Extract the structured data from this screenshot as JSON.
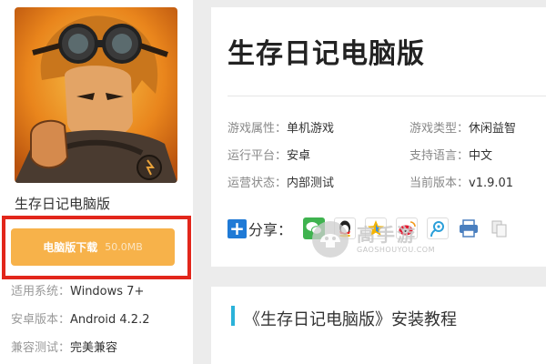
{
  "app": {
    "name": "生存日记电脑版",
    "title": "生存日记电脑版"
  },
  "download": {
    "label": "电脑版下载",
    "size": "50.0MB"
  },
  "left_meta": [
    {
      "key": "适用系统：",
      "value": "Windows 7+"
    },
    {
      "key": "安卓版本：",
      "value": "Android 4.2.2"
    },
    {
      "key": "兼容测试：",
      "value": "完美兼容"
    }
  ],
  "attributes": [
    {
      "key": "游戏属性：",
      "value": "单机游戏"
    },
    {
      "key": "游戏类型：",
      "value": "休闲益智"
    },
    {
      "key": "运行平台：",
      "value": "安卓"
    },
    {
      "key": "支持语言：",
      "value": "中文"
    },
    {
      "key": "运营状态：",
      "value": "内部测试"
    },
    {
      "key": "当前版本：",
      "value": "v1.9.01"
    }
  ],
  "share": {
    "plus": "+",
    "label": "分享：",
    "icons": [
      "wechat-icon",
      "qq-icon",
      "qzone-icon",
      "weibo-icon",
      "tencent-weibo-icon",
      "print-icon",
      "copy-icon"
    ]
  },
  "watermark": {
    "text": "高手游",
    "sub": "GAOSHOUYOU.COM"
  },
  "tutorial": {
    "title": "《生存日记电脑版》安装教程"
  },
  "colors": {
    "download_button": "#f7b24a",
    "highlight_outline": "#e2261b",
    "accent_bar": "#2bb2d9",
    "share_plus": "#1f7ad6"
  }
}
